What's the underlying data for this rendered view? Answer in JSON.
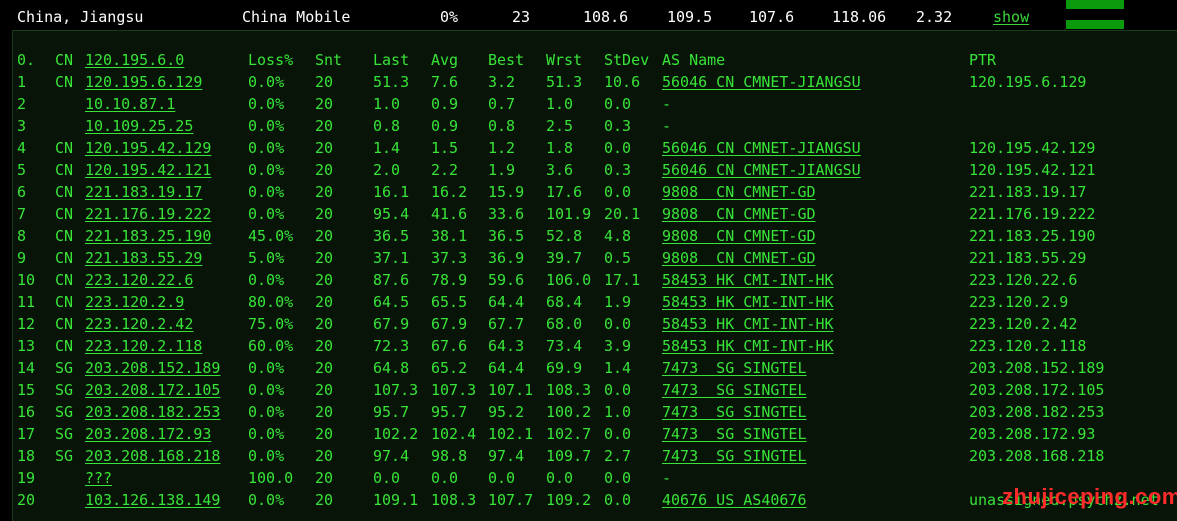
{
  "summary": {
    "location": "China, Jiangsu",
    "isp": "China Mobile",
    "loss": "0%",
    "snt": "23",
    "last": "108.6",
    "avg": "109.5",
    "best": "107.6",
    "wrst": "118.06",
    "stdev": "2.32",
    "action": "show"
  },
  "header": {
    "idx": "0.",
    "cc": "CN",
    "ip": "120.195.6.0",
    "loss": "Loss%",
    "snt": "Snt",
    "last": "Last",
    "avg": "Avg",
    "best": "Best",
    "wrst": "Wrst",
    "stdev": "StDev",
    "as": "AS Name",
    "ptr": "PTR"
  },
  "hops": [
    {
      "idx": "1",
      "cc": "CN",
      "ip": "120.195.6.129",
      "loss": "0.0%",
      "snt": "20",
      "last": "51.3",
      "avg": "7.6",
      "best": "3.2",
      "wrst": "51.3",
      "stdev": "10.6",
      "as": "56046 CN CMNET-JIANGSU",
      "ptr": "120.195.6.129"
    },
    {
      "idx": "2",
      "cc": "",
      "ip": "10.10.87.1",
      "loss": "0.0%",
      "snt": "20",
      "last": "1.0",
      "avg": "0.9",
      "best": "0.7",
      "wrst": "1.0",
      "stdev": "0.0",
      "as": "-",
      "ptr": ""
    },
    {
      "idx": "3",
      "cc": "",
      "ip": "10.109.25.25",
      "loss": "0.0%",
      "snt": "20",
      "last": "0.8",
      "avg": "0.9",
      "best": "0.8",
      "wrst": "2.5",
      "stdev": "0.3",
      "as": "-",
      "ptr": ""
    },
    {
      "idx": "4",
      "cc": "CN",
      "ip": "120.195.42.129",
      "loss": "0.0%",
      "snt": "20",
      "last": "1.4",
      "avg": "1.5",
      "best": "1.2",
      "wrst": "1.8",
      "stdev": "0.0",
      "as": "56046 CN CMNET-JIANGSU",
      "ptr": "120.195.42.129"
    },
    {
      "idx": "5",
      "cc": "CN",
      "ip": "120.195.42.121",
      "loss": "0.0%",
      "snt": "20",
      "last": "2.0",
      "avg": "2.2",
      "best": "1.9",
      "wrst": "3.6",
      "stdev": "0.3",
      "as": "56046 CN CMNET-JIANGSU",
      "ptr": "120.195.42.121"
    },
    {
      "idx": "6",
      "cc": "CN",
      "ip": "221.183.19.17",
      "loss": "0.0%",
      "snt": "20",
      "last": "16.1",
      "avg": "16.2",
      "best": "15.9",
      "wrst": "17.6",
      "stdev": "0.0",
      "as": "9808  CN CMNET-GD",
      "ptr": "221.183.19.17"
    },
    {
      "idx": "7",
      "cc": "CN",
      "ip": "221.176.19.222",
      "loss": "0.0%",
      "snt": "20",
      "last": "95.4",
      "avg": "41.6",
      "best": "33.6",
      "wrst": "101.9",
      "stdev": "20.1",
      "as": "9808  CN CMNET-GD",
      "ptr": "221.176.19.222"
    },
    {
      "idx": "8",
      "cc": "CN",
      "ip": "221.183.25.190",
      "loss": "45.0%",
      "snt": "20",
      "last": "36.5",
      "avg": "38.1",
      "best": "36.5",
      "wrst": "52.8",
      "stdev": "4.8",
      "as": "9808  CN CMNET-GD",
      "ptr": "221.183.25.190"
    },
    {
      "idx": "9",
      "cc": "CN",
      "ip": "221.183.55.29",
      "loss": "5.0%",
      "snt": "20",
      "last": "37.1",
      "avg": "37.3",
      "best": "36.9",
      "wrst": "39.7",
      "stdev": "0.5",
      "as": "9808  CN CMNET-GD",
      "ptr": "221.183.55.29"
    },
    {
      "idx": "10",
      "cc": "CN",
      "ip": "223.120.22.6",
      "loss": "0.0%",
      "snt": "20",
      "last": "87.6",
      "avg": "78.9",
      "best": "59.6",
      "wrst": "106.0",
      "stdev": "17.1",
      "as": "58453 HK CMI-INT-HK",
      "ptr": "223.120.22.6"
    },
    {
      "idx": "11",
      "cc": "CN",
      "ip": "223.120.2.9",
      "loss": "80.0%",
      "snt": "20",
      "last": "64.5",
      "avg": "65.5",
      "best": "64.4",
      "wrst": "68.4",
      "stdev": "1.9",
      "as": "58453 HK CMI-INT-HK",
      "ptr": "223.120.2.9"
    },
    {
      "idx": "12",
      "cc": "CN",
      "ip": "223.120.2.42",
      "loss": "75.0%",
      "snt": "20",
      "last": "67.9",
      "avg": "67.9",
      "best": "67.7",
      "wrst": "68.0",
      "stdev": "0.0",
      "as": "58453 HK CMI-INT-HK",
      "ptr": "223.120.2.42"
    },
    {
      "idx": "13",
      "cc": "CN",
      "ip": "223.120.2.118",
      "loss": "60.0%",
      "snt": "20",
      "last": "72.3",
      "avg": "67.6",
      "best": "64.3",
      "wrst": "73.4",
      "stdev": "3.9",
      "as": "58453 HK CMI-INT-HK",
      "ptr": "223.120.2.118"
    },
    {
      "idx": "14",
      "cc": "SG",
      "ip": "203.208.152.189",
      "loss": "0.0%",
      "snt": "20",
      "last": "64.8",
      "avg": "65.2",
      "best": "64.4",
      "wrst": "69.9",
      "stdev": "1.4",
      "as": "7473  SG SINGTEL",
      "ptr": "203.208.152.189"
    },
    {
      "idx": "15",
      "cc": "SG",
      "ip": "203.208.172.105",
      "loss": "0.0%",
      "snt": "20",
      "last": "107.3",
      "avg": "107.3",
      "best": "107.1",
      "wrst": "108.3",
      "stdev": "0.0",
      "as": "7473  SG SINGTEL",
      "ptr": "203.208.172.105"
    },
    {
      "idx": "16",
      "cc": "SG",
      "ip": "203.208.182.253",
      "loss": "0.0%",
      "snt": "20",
      "last": "95.7",
      "avg": "95.7",
      "best": "95.2",
      "wrst": "100.2",
      "stdev": "1.0",
      "as": "7473  SG SINGTEL",
      "ptr": "203.208.182.253"
    },
    {
      "idx": "17",
      "cc": "SG",
      "ip": "203.208.172.93",
      "loss": "0.0%",
      "snt": "20",
      "last": "102.2",
      "avg": "102.4",
      "best": "102.1",
      "wrst": "102.7",
      "stdev": "0.0",
      "as": "7473  SG SINGTEL",
      "ptr": "203.208.172.93"
    },
    {
      "idx": "18",
      "cc": "SG",
      "ip": "203.208.168.218",
      "loss": "0.0%",
      "snt": "20",
      "last": "97.4",
      "avg": "98.8",
      "best": "97.4",
      "wrst": "109.7",
      "stdev": "2.7",
      "as": "7473  SG SINGTEL",
      "ptr": "203.208.168.218"
    },
    {
      "idx": "19",
      "cc": "",
      "ip": "???",
      "loss": "100.0",
      "snt": "20",
      "last": "0.0",
      "avg": "0.0",
      "best": "0.0",
      "wrst": "0.0",
      "stdev": "0.0",
      "as": "-",
      "ptr": ""
    },
    {
      "idx": "20",
      "cc": "",
      "ip": "103.126.138.149",
      "loss": "0.0%",
      "snt": "20",
      "last": "109.1",
      "avg": "108.3",
      "best": "107.7",
      "wrst": "109.2",
      "stdev": "0.0",
      "as": "40676 US AS40676",
      "ptr": "unassigned.psychz.net"
    }
  ],
  "watermark": "zhujiceping.com",
  "colors": {
    "text_green": "#37e437",
    "panel_bg": "#071407",
    "summary_text": "#ffffff",
    "bar_green": "#0b9a0b",
    "watermark_red": "#ff2a2a"
  }
}
